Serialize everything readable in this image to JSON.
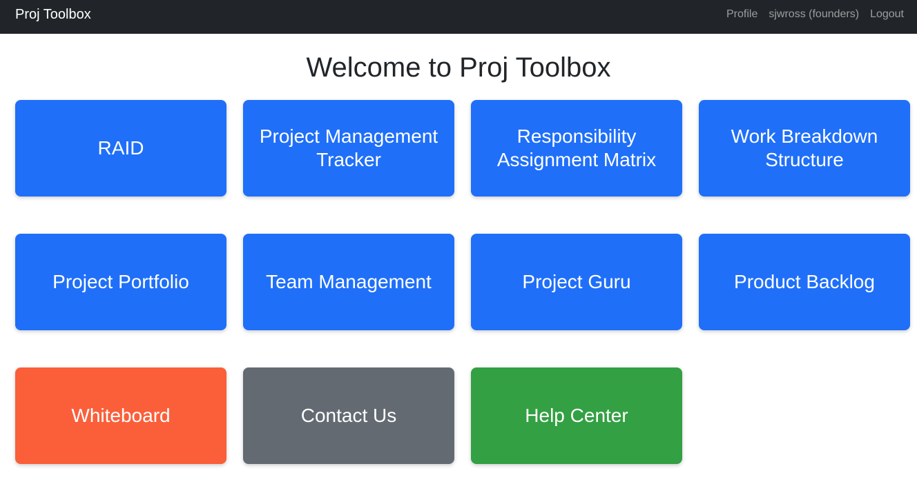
{
  "navbar": {
    "brand": "Proj Toolbox",
    "links": [
      "Profile",
      "sjwross (founders)",
      "Logout"
    ]
  },
  "page": {
    "title": "Welcome to Proj Toolbox"
  },
  "tiles": [
    {
      "label": "RAID",
      "color": "#1f6ff9"
    },
    {
      "label": "Project Management Tracker",
      "color": "#1f6ff9"
    },
    {
      "label": "Responsibility Assignment Matrix",
      "color": "#1f6ff9"
    },
    {
      "label": "Work Breakdown Structure",
      "color": "#1f6ff9"
    },
    {
      "label": "Project Portfolio",
      "color": "#1f6ff9"
    },
    {
      "label": "Team Management",
      "color": "#1f6ff9"
    },
    {
      "label": "Project Guru",
      "color": "#1f6ff9"
    },
    {
      "label": "Product Backlog",
      "color": "#1f6ff9"
    },
    {
      "label": "Whiteboard",
      "color": "#fa5f3a"
    },
    {
      "label": "Contact Us",
      "color": "#636a72"
    },
    {
      "label": "Help Center",
      "color": "#33a043"
    }
  ]
}
